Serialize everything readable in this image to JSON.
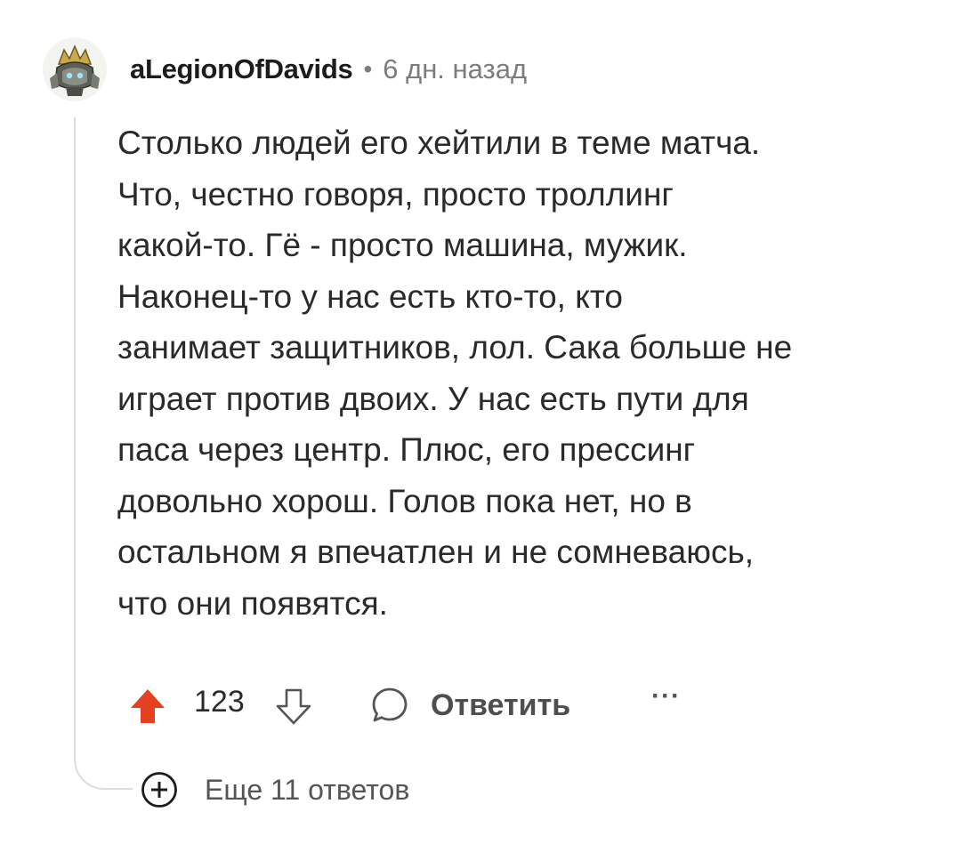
{
  "comment": {
    "username": "aLegionOfDavids",
    "separator": "•",
    "timestamp": "6 дн. назад",
    "body_lines": [
      "Столько людей его хейтили в теме матча.",
      "Что, честно говоря, просто троллинг",
      "какой-то. Гё - просто машина, мужик.",
      "Наконец-то у нас есть кто-то, кто",
      "занимает защитников, лол. Сака больше не",
      "играет против двоих. У нас есть пути для",
      "паса через центр. Плюс, его прессинг",
      "довольно хорош. Голов пока нет, но в",
      "остальном я впечатлен и не сомневаюсь,",
      "что они появятся."
    ],
    "vote_count": "123",
    "upvoted": true,
    "reply_label": "Ответить",
    "more_label": "···"
  },
  "thread": {
    "more_replies_label": "Еще 11 ответов"
  },
  "icons": {
    "avatar": "avatar-robot-knight",
    "upvote": "arrow-up-icon",
    "downvote": "arrow-down-icon",
    "reply": "speech-bubble-icon",
    "more": "ellipsis-icon",
    "expand": "plus-circle-icon"
  },
  "colors": {
    "upvote_active": "#e5401f",
    "text": "#2a2a2a",
    "muted": "#7c7c7c",
    "thread_line": "#dcdcdc"
  }
}
